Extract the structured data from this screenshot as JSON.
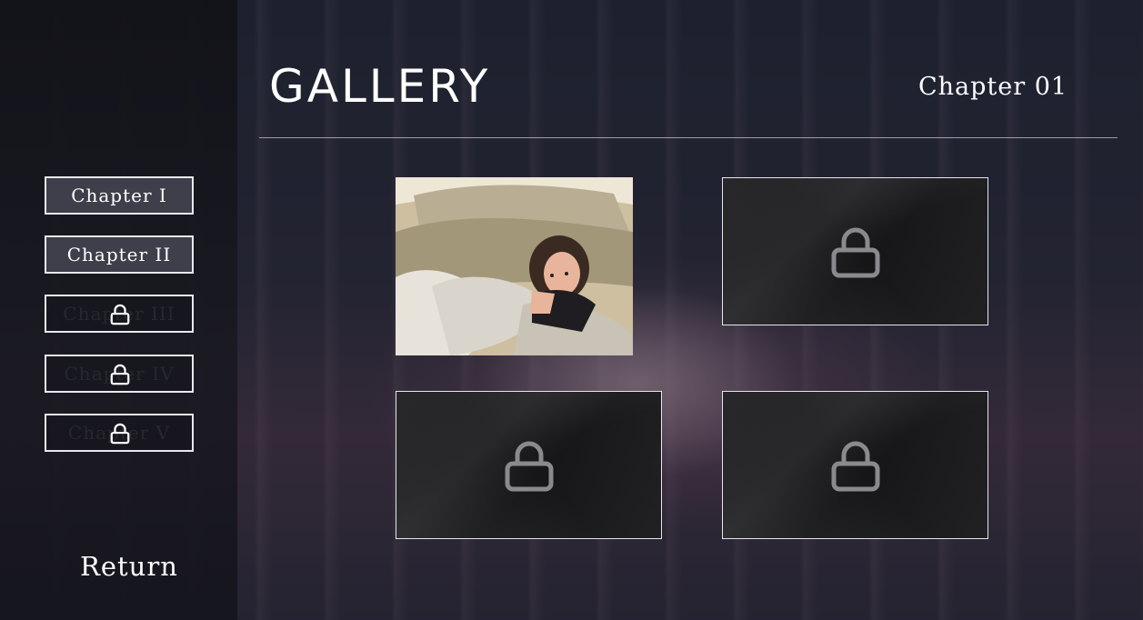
{
  "page": {
    "title": "GALLERY",
    "current_chapter": "Chapter 01"
  },
  "sidebar": {
    "chapters": [
      {
        "label": "Chapter I",
        "locked": false
      },
      {
        "label": "Chapter II",
        "locked": false
      },
      {
        "label": "Chapter III",
        "locked": true
      },
      {
        "label": "Chapter IV",
        "locked": true
      },
      {
        "label": "Chapter V",
        "locked": true
      }
    ],
    "return_label": "Return"
  },
  "gallery": {
    "items": [
      {
        "state": "unlocked",
        "icon": "artwork"
      },
      {
        "state": "locked",
        "icon": "lock-icon"
      },
      {
        "state": "locked",
        "icon": "lock-icon"
      },
      {
        "state": "locked",
        "icon": "lock-icon"
      }
    ]
  }
}
